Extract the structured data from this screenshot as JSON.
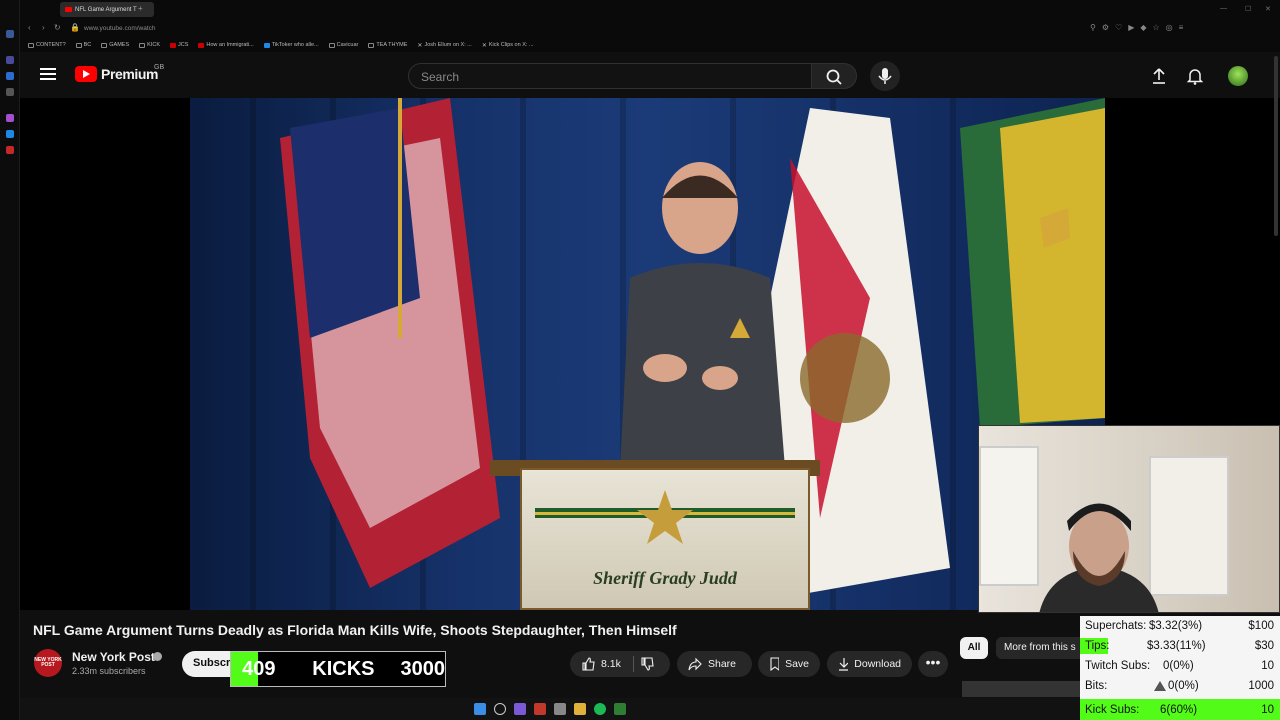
{
  "browser": {
    "tab_title": "NFL Game Argument T",
    "url": "www.youtube.com/watch",
    "bookmarks": [
      "CONTENT?",
      "BC",
      "GAMES",
      "KICK",
      "JCS",
      "How an Immigrati...",
      "TikToker who alle...",
      "Cavicuar",
      "TEA THYME",
      "Josh Ellum on X: ...",
      "Kick Clips on X: ..."
    ]
  },
  "header": {
    "logo_text": "Premium",
    "region": "GB",
    "search_placeholder": "Search"
  },
  "video": {
    "podium_text": "Sheriff Grady Judd"
  },
  "info": {
    "title": "NFL Game Argument Turns Deadly as Florida Man Kills Wife, Shoots Stepdaughter, Then Himself",
    "channel_name": "New York Post",
    "channel_avatar_text": "NEW YORK POST",
    "subscribers": "2.33m subscribers",
    "subscribe_label": "Subscribe",
    "like_count": "8.1k",
    "share_label": "Share",
    "save_label": "Save",
    "download_label": "Download",
    "more_label": "•••"
  },
  "chips": {
    "all": "All",
    "more": "More from this s"
  },
  "kicks": {
    "count": "409",
    "label": "KICKS",
    "goal": "3000",
    "progress_fraction": 0.136
  },
  "stats": {
    "superchats": {
      "label": "Superchats:",
      "value": "$3.32(3%)",
      "goal": "$100"
    },
    "tips": {
      "label": "Tips:",
      "value": "$3.33(11%)",
      "goal": "$30"
    },
    "twitch": {
      "label": "Twitch Subs:",
      "value": "0(0%)",
      "goal": "10"
    },
    "bits": {
      "label": "Bits:",
      "value": "0(0%)",
      "goal": "1000"
    },
    "kick": {
      "label": "Kick Subs:",
      "value": "6(60%)",
      "goal": "10"
    }
  },
  "colors": {
    "kick_green": "#53fc18",
    "youtube_red": "#ff0000",
    "background": "#0f0f0f"
  }
}
